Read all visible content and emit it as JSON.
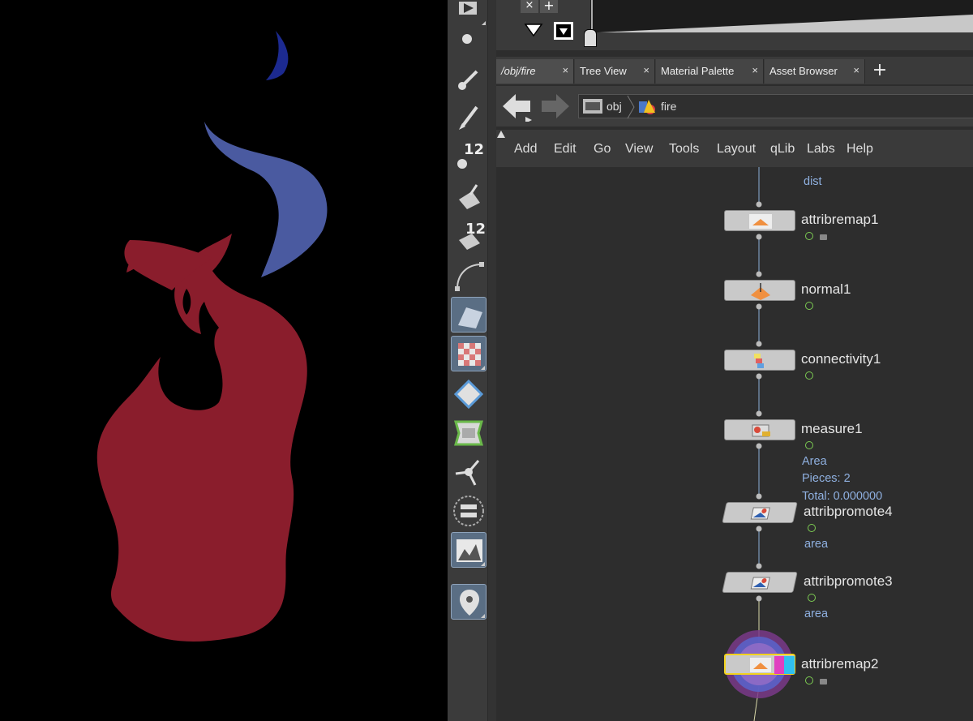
{
  "app": {
    "tabs": [
      {
        "label": "/obj/fire",
        "active": true
      },
      {
        "label": "Tree View",
        "active": false
      },
      {
        "label": "Material Palette",
        "active": false
      },
      {
        "label": "Asset Browser",
        "active": false
      }
    ],
    "tab_close_glyph": "×",
    "add_tab_glyph": "+",
    "path": {
      "root": "obj",
      "current": "fire"
    },
    "menu": [
      "Add",
      "Edit",
      "Go",
      "View",
      "Tools",
      "Layout",
      "qLib",
      "Labs",
      "Help"
    ]
  },
  "shelf": {
    "tools": [
      {
        "icon": "render-icon"
      },
      {
        "icon": "point-icon"
      },
      {
        "icon": "brush-icon"
      },
      {
        "icon": "paint-icon"
      },
      {
        "icon": "count-icon",
        "badge": "12"
      },
      {
        "icon": "eraser-icon"
      },
      {
        "icon": "count2-icon",
        "badge": "12"
      },
      {
        "icon": "curve-icon"
      },
      {
        "icon": "plane-icon",
        "active": true
      },
      {
        "icon": "uv-checker-icon",
        "active": true
      },
      {
        "icon": "diamond-icon"
      },
      {
        "icon": "frame-icon"
      },
      {
        "icon": "pin-tool-icon"
      },
      {
        "icon": "circle-bar-icon"
      },
      {
        "icon": "terrain-icon",
        "active": true
      },
      {
        "icon": "location-pin-icon",
        "active": true
      }
    ]
  },
  "network": {
    "top_label": "dist",
    "nodes": [
      {
        "name": "attribremap1",
        "icon": "attribremap-icon",
        "info": [],
        "locked": true
      },
      {
        "name": "normal1",
        "icon": "normal-icon",
        "info": [],
        "locked": false
      },
      {
        "name": "connectivity1",
        "icon": "connectivity-icon",
        "info": [],
        "locked": false
      },
      {
        "name": "measure1",
        "icon": "measure-icon",
        "info": [
          "Area",
          "Pieces: 2",
          "Total: 0.000000"
        ],
        "locked": false
      },
      {
        "name": "attribpromote4",
        "icon": "attribpromote-icon",
        "info": [
          "area"
        ],
        "locked": false
      },
      {
        "name": "attribpromote3",
        "icon": "attribpromote-icon",
        "info": [
          "area"
        ],
        "locked": false
      },
      {
        "name": "attribremap2",
        "icon": "attribremap-icon",
        "info": [],
        "locked": true,
        "selected": true,
        "display": true
      }
    ]
  },
  "colors": {
    "shape_red": "#8a1d2c",
    "shape_blue": "#4a5aa0",
    "shape_dark_blue": "#1c2a90",
    "selected_outline": "#f2d21e",
    "info_text": "#8fb0e0"
  }
}
